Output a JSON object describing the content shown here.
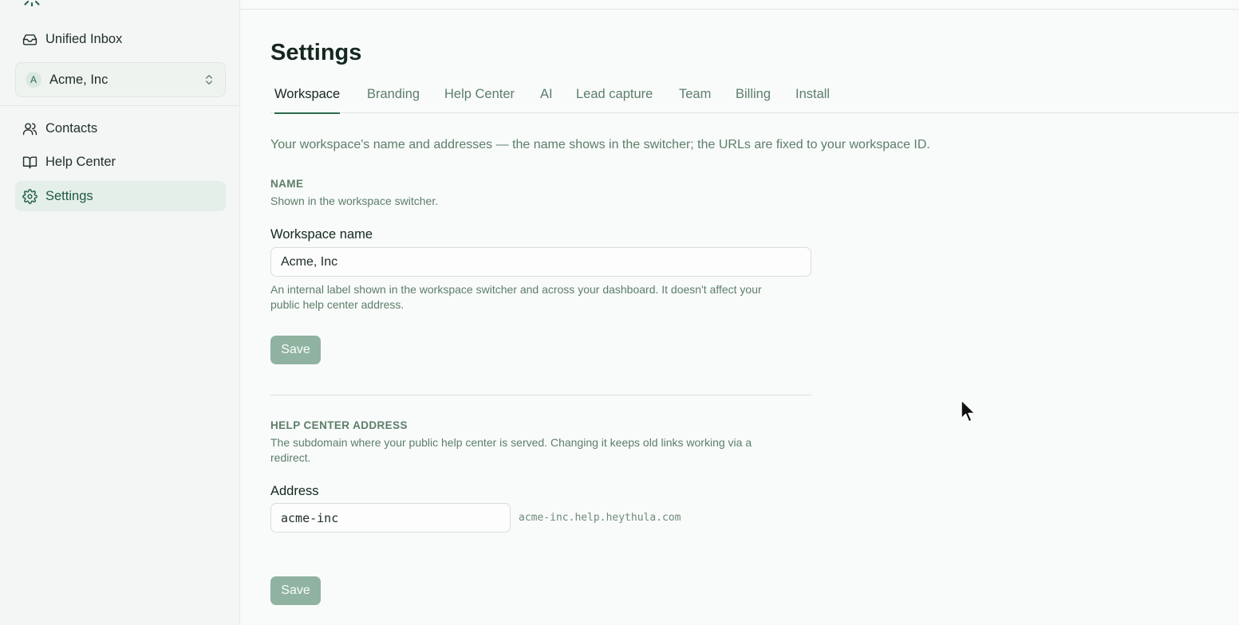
{
  "sidebar": {
    "items": [
      {
        "label": "Unified Inbox",
        "icon": "inbox-icon"
      },
      {
        "label": "Contacts",
        "icon": "users-icon"
      },
      {
        "label": "Help Center",
        "icon": "book-icon"
      },
      {
        "label": "Settings",
        "icon": "gear-icon"
      }
    ],
    "workspace": {
      "avatar": "A",
      "name": "Acme, Inc"
    }
  },
  "main": {
    "title": "Settings",
    "tabs": [
      "Workspace",
      "Branding",
      "Help Center",
      "AI",
      "Lead capture",
      "Team",
      "Billing",
      "Install"
    ],
    "active_tab": "Workspace",
    "intro": "Your workspace's name and addresses — the name shows in the switcher; the URLs are fixed to your workspace ID.",
    "name_section": {
      "label": "NAME",
      "help": "Shown in the workspace switcher.",
      "field_label": "Workspace name",
      "value": "Acme, Inc",
      "hint": "An internal label shown in the workspace switcher and across your dashboard. It doesn't affect your public help center address.",
      "save": "Save"
    },
    "address_section": {
      "label": "HELP CENTER ADDRESS",
      "help": "The subdomain where your public help center is served. Changing it keeps old links working via a redirect.",
      "field_label": "Address",
      "value": "acme-inc",
      "suffix": "acme-inc.help.heythula.com",
      "save": "Save"
    }
  },
  "colors": {
    "accent": "#2d6a4f",
    "save_button": "#8fb3a0",
    "active_nav": "#e5efea"
  }
}
